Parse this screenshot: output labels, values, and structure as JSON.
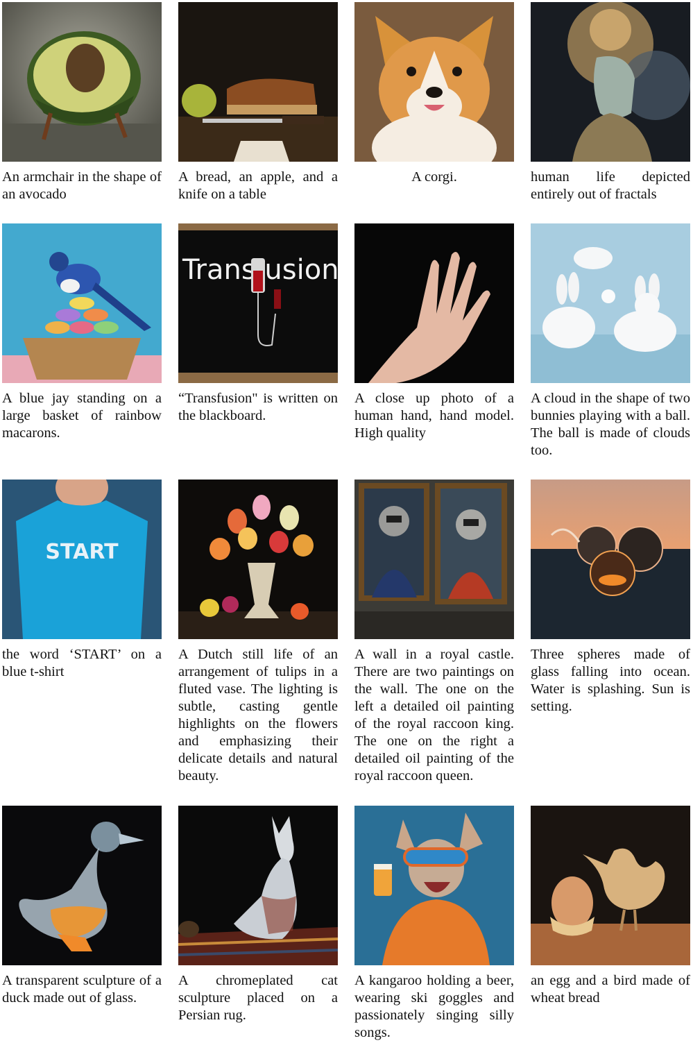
{
  "figure": {
    "items": [
      {
        "caption": "An armchair in the shape of an avocado",
        "image": "avocado-armchair-image"
      },
      {
        "caption": "A bread, an apple, and a knife on a table",
        "image": "bread-apple-knife-image"
      },
      {
        "caption": "A corgi.",
        "image": "corgi-image"
      },
      {
        "caption": "human life depicted entirely out of fractals",
        "image": "fractal-human-image"
      },
      {
        "caption": "A blue jay standing on a large basket of rainbow macarons.",
        "image": "blue-jay-macarons-image"
      },
      {
        "caption": "“Transfusion\" is written on the blackboard.",
        "image": "transfusion-blackboard-image",
        "board_text": "Trans  usion"
      },
      {
        "caption": "A close up photo of a human hand, hand model. High quality",
        "image": "hand-image"
      },
      {
        "caption": "A cloud in the shape of two bunnies playing with a ball. The ball is made of clouds too.",
        "image": "cloud-bunnies-image"
      },
      {
        "caption": "the word ‘START’ on a blue t-shirt",
        "image": "start-tshirt-image",
        "shirt_text": "START"
      },
      {
        "caption": "A Dutch still life of an arrangement of tulips in a fluted vase. The lighting is subtle, casting gentle highlights on the flowers and emphasizing their delicate details and natural beauty.",
        "image": "tulips-still-life-image"
      },
      {
        "caption": "A wall in a royal castle. There are two paintings on the wall. The one on the left a detailed oil painting of the royal raccoon king. The one on the right a detailed oil painting of the royal raccoon queen.",
        "image": "raccoon-paintings-image"
      },
      {
        "caption": "Three spheres made of glass falling into ocean. Water is splashing. Sun is setting.",
        "image": "glass-spheres-ocean-image"
      },
      {
        "caption": "A transparent sculpture of a duck made out of glass.",
        "image": "glass-duck-image"
      },
      {
        "caption": "A chromeplated cat sculpture placed on a Persian rug.",
        "image": "chrome-cat-image"
      },
      {
        "caption": "A kangaroo holding a beer, wearing ski goggles and passionately singing silly songs.",
        "image": "kangaroo-image"
      },
      {
        "caption": "an egg and a bird made of wheat bread",
        "image": "egg-bread-bird-image"
      }
    ]
  }
}
